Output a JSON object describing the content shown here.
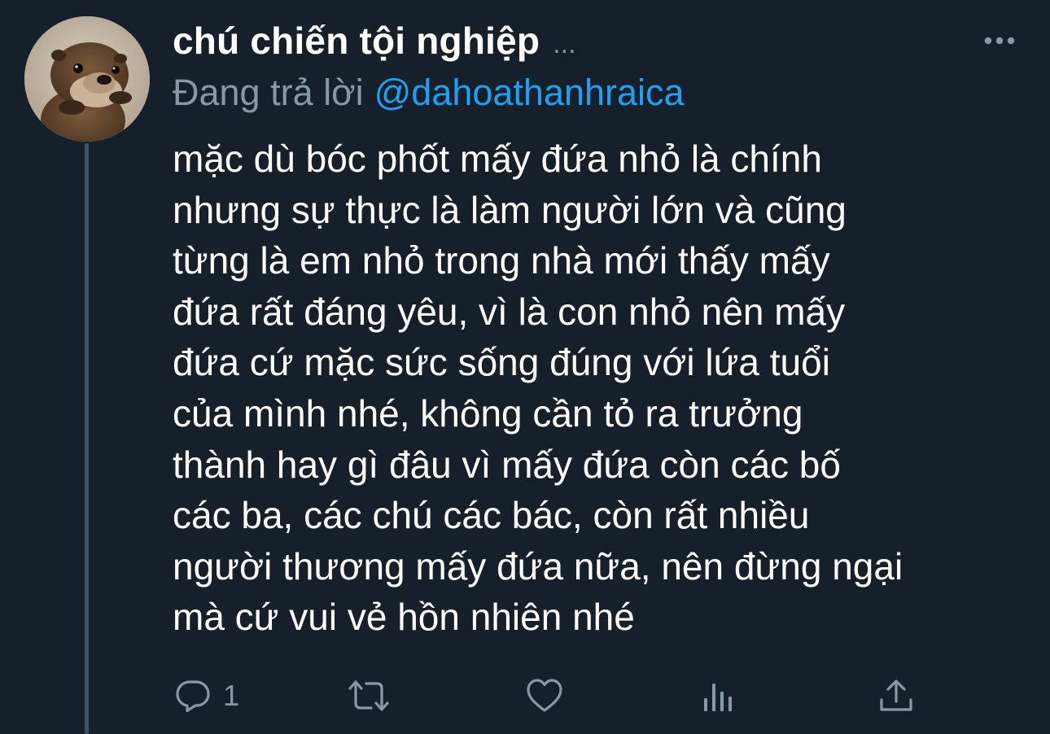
{
  "tweet": {
    "display_name": "chú chiến tội nghiệp",
    "name_overflow": "...",
    "reply_prefix": "Đang trả lời",
    "reply_handle": "@dahoathanhraica",
    "text_lines": [
      "mặc dù bóc phốt mấy đứa nhỏ là chính",
      "nhưng sự thực là làm người lớn và cũng",
      "từng là em nhỏ trong nhà mới thấy mấy",
      "đứa rất đáng yêu, vì là con nhỏ nên mấy",
      "đứa cứ mặc sức sống đúng với lứa tuổi",
      "của mình nhé, không cần tỏ ra trưởng",
      "thành hay gì đâu vì mấy đứa còn các bố",
      "các ba, các chú các bác, còn rất nhiều",
      "người thương mấy đứa nữa, nên đừng ngại",
      "mà cứ vui vẻ hồn nhiên nhé"
    ]
  },
  "actions": {
    "reply_icon": "reply-bubble",
    "reply_count": "1",
    "retweet_icon": "retweet-arrows",
    "like_icon": "heart-outline",
    "analytics_icon": "bar-chart",
    "share_icon": "share-upload"
  },
  "colors": {
    "background": "#15202b",
    "text": "#ffffff",
    "secondary": "#8899a6",
    "link": "#1da1f2",
    "thread_line": "#3d5466"
  }
}
